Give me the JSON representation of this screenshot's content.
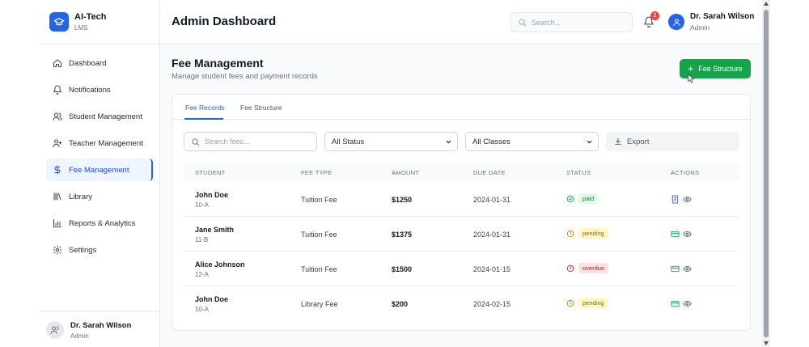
{
  "brand": {
    "title": "AI-Tech",
    "subtitle": "LMS"
  },
  "sidebar": {
    "items": [
      {
        "label": "Dashboard",
        "icon": "home-icon",
        "active": false
      },
      {
        "label": "Notifications",
        "icon": "bell-icon",
        "active": false
      },
      {
        "label": "Student Management",
        "icon": "users-icon",
        "active": false
      },
      {
        "label": "Teacher Management",
        "icon": "user-plus-icon",
        "active": false
      },
      {
        "label": "Fee Management",
        "icon": "dollar-icon",
        "active": true
      },
      {
        "label": "Library",
        "icon": "library-icon",
        "active": false
      },
      {
        "label": "Reports & Analytics",
        "icon": "bar-chart-icon",
        "active": false
      },
      {
        "label": "Settings",
        "icon": "gear-icon",
        "active": false
      }
    ],
    "user": {
      "name": "Dr. Sarah Wilson",
      "role": "Admin"
    }
  },
  "header": {
    "title": "Admin Dashboard",
    "search_placeholder": "Search...",
    "notification_count": "2",
    "user": {
      "name": "Dr. Sarah Wilson",
      "role": "Admin"
    }
  },
  "page": {
    "title": "Fee Management",
    "subtitle": "Manage student fees and payment records",
    "add_button": "Fee Structure"
  },
  "tabs": [
    {
      "label": "Fee Records",
      "active": true
    },
    {
      "label": "Fee Structure",
      "active": false
    }
  ],
  "filters": {
    "search_placeholder": "Search fees...",
    "status_selected": "All Status",
    "class_selected": "All Classes",
    "export_label": "Export"
  },
  "table": {
    "headers": [
      "STUDENT",
      "FEE TYPE",
      "AMOUNT",
      "DUE DATE",
      "STATUS",
      "ACTIONS"
    ],
    "rows": [
      {
        "name": "John Doe",
        "class": "10-A",
        "fee_type": "Tuition Fee",
        "amount": "$1250",
        "due_date": "2024-01-31",
        "status": "paid"
      },
      {
        "name": "Jane Smith",
        "class": "11-B",
        "fee_type": "Tuition Fee",
        "amount": "$1375",
        "due_date": "2024-01-31",
        "status": "pending"
      },
      {
        "name": "Alice Johnson",
        "class": "12-A",
        "fee_type": "Tuition Fee",
        "amount": "$1500",
        "due_date": "2024-01-15",
        "status": "overdue"
      },
      {
        "name": "John Doe",
        "class": "10-A",
        "fee_type": "Library Fee",
        "amount": "$200",
        "due_date": "2024-02-15",
        "status": "pending"
      }
    ]
  },
  "colors": {
    "primary": "#2563eb",
    "success": "#16a34a",
    "paid_bg": "#dcfce7",
    "paid_fg": "#15803d",
    "pending_bg": "#fef9c3",
    "pending_fg": "#a16207",
    "overdue_bg": "#fee2e2",
    "overdue_fg": "#b91c1c"
  }
}
